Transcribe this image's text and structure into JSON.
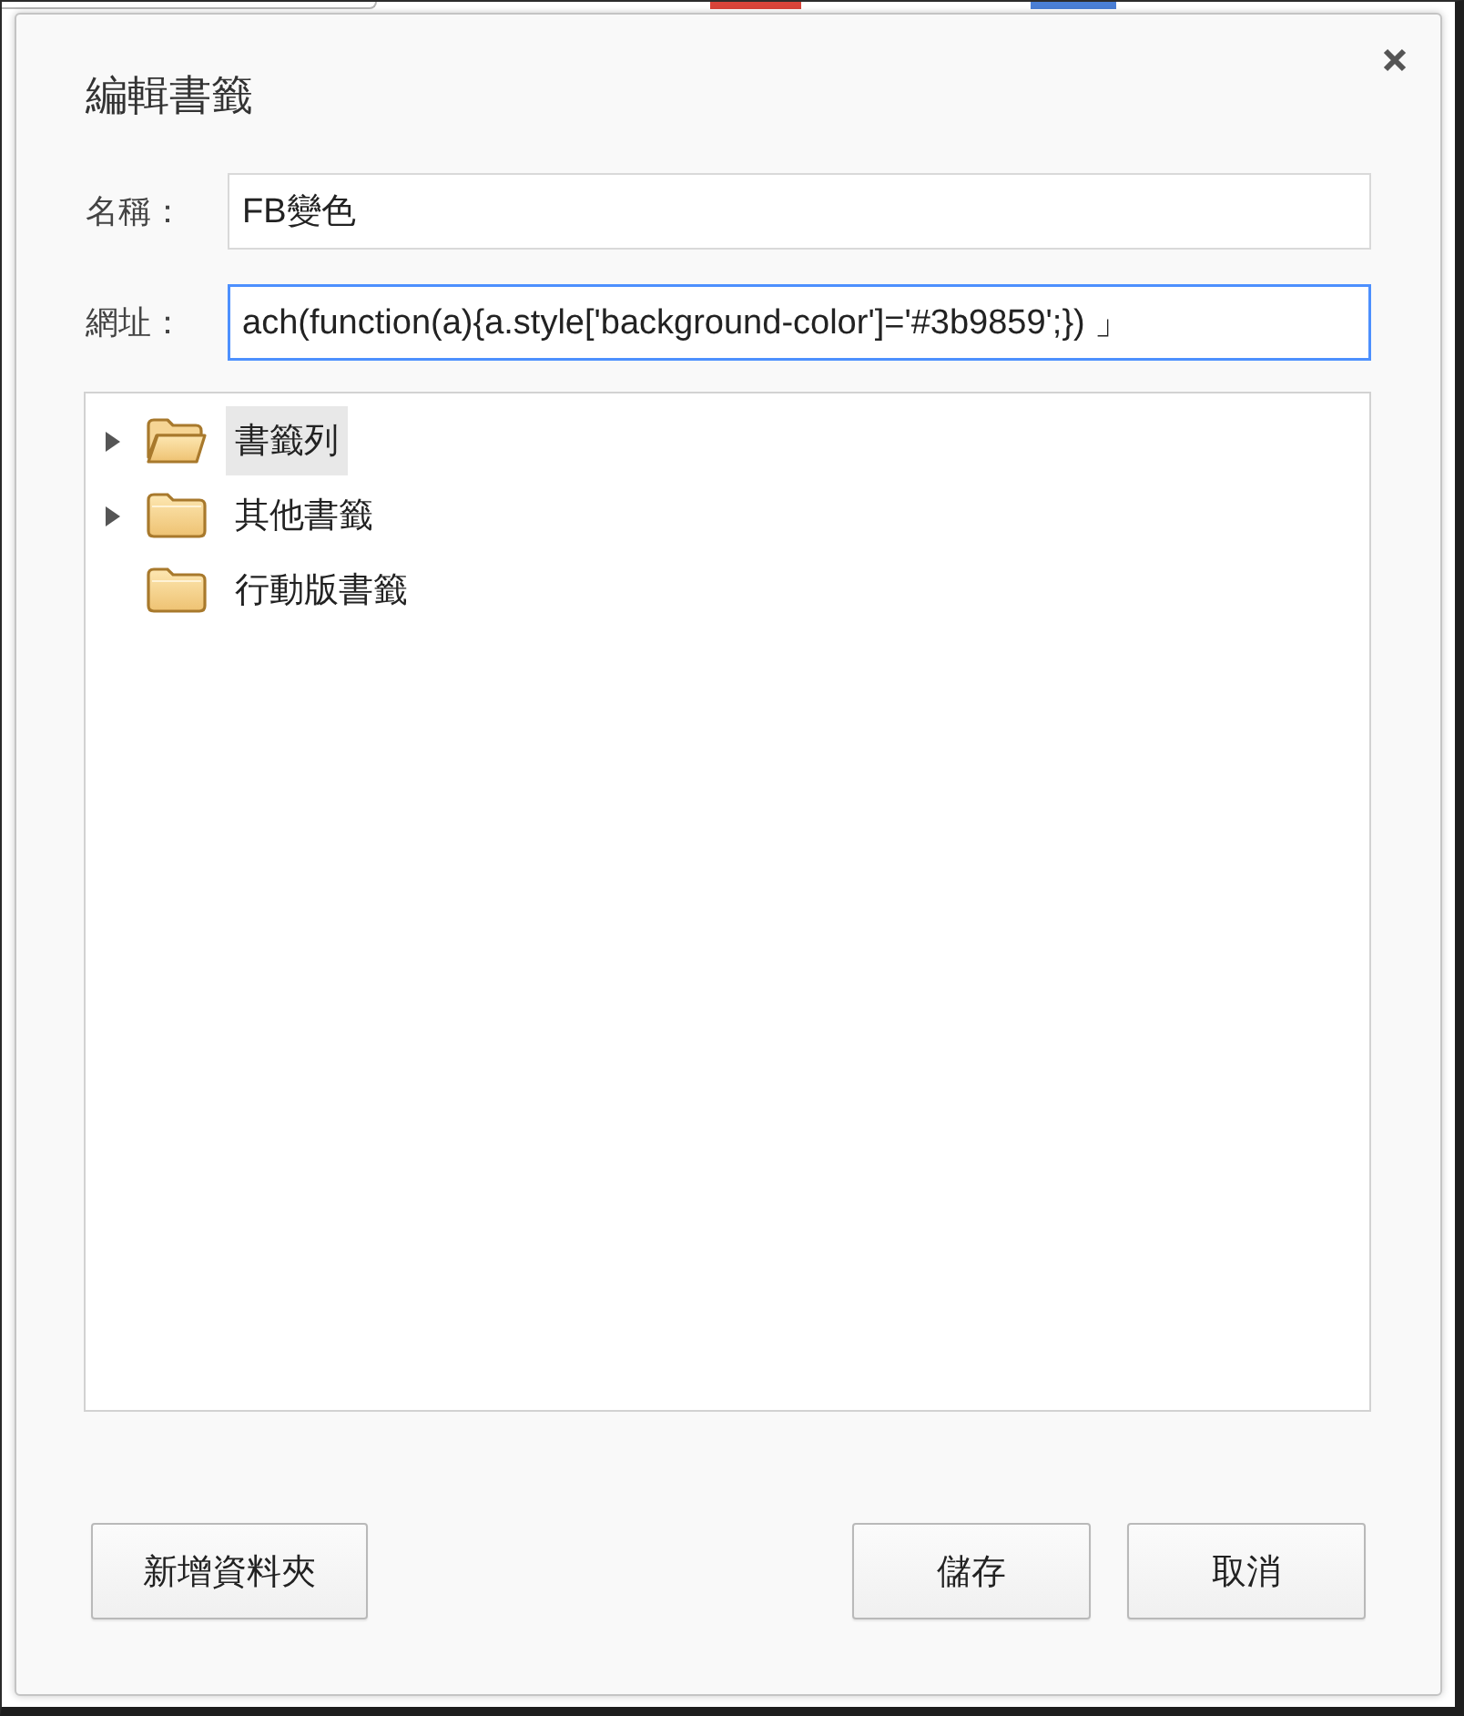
{
  "dialog": {
    "title": "編輯書籤"
  },
  "fields": [
    {
      "label": "名稱：",
      "value": "FB變色",
      "focused": false
    },
    {
      "label": "網址：",
      "value": "ach(function(a){a.style['background-color']='#3b9859';}) 」",
      "focused": true
    }
  ],
  "folders": [
    {
      "label": "書籤列",
      "selected": true,
      "expandable": true
    },
    {
      "label": "其他書籤",
      "selected": false,
      "expandable": true
    },
    {
      "label": "行動版書籤",
      "selected": false,
      "expandable": false
    }
  ],
  "buttons": [
    {
      "label": "新增資料夾",
      "kind": "secondary"
    },
    {
      "label": "儲存",
      "kind": "primary"
    },
    {
      "label": "取消",
      "kind": "primary"
    }
  ]
}
